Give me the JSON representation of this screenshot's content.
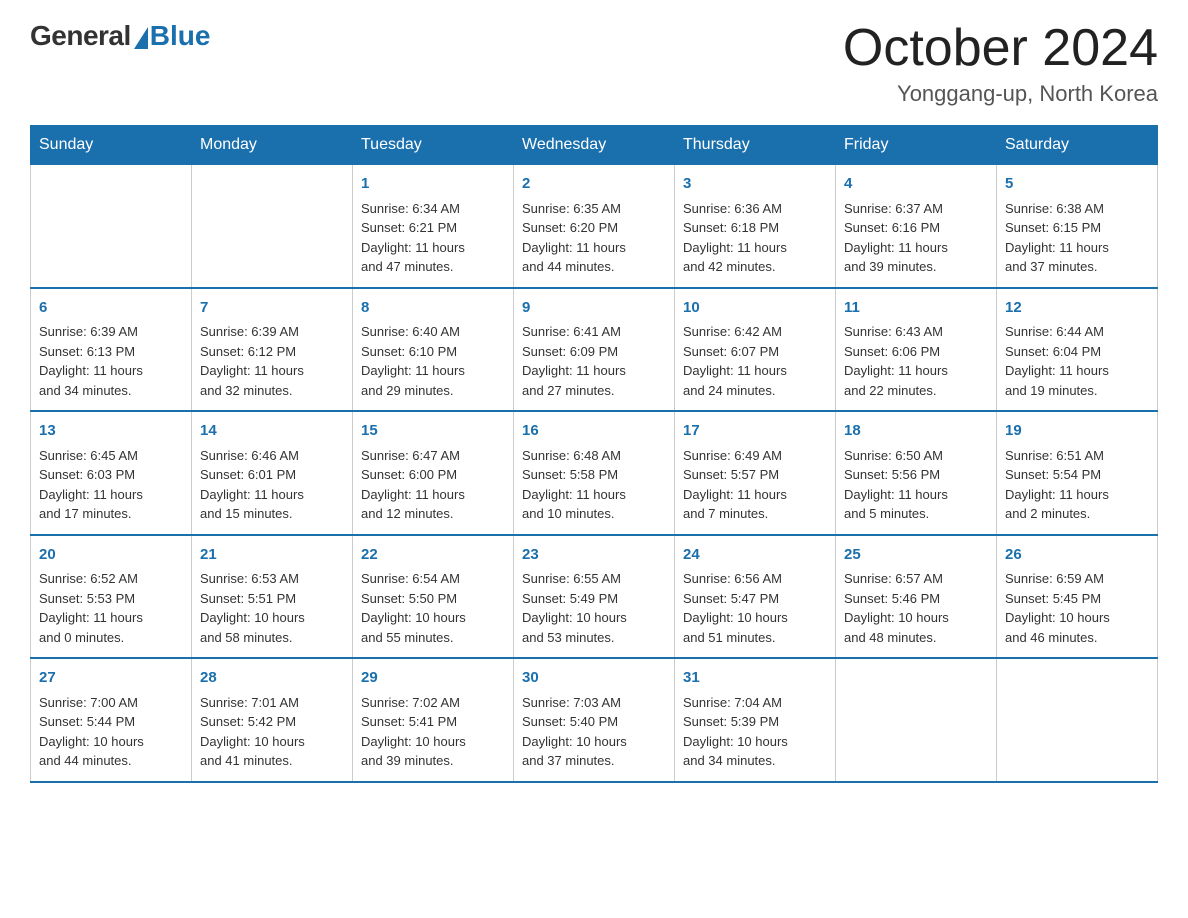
{
  "logo": {
    "general": "General",
    "blue": "Blue"
  },
  "title": "October 2024",
  "subtitle": "Yonggang-up, North Korea",
  "weekdays": [
    "Sunday",
    "Monday",
    "Tuesday",
    "Wednesday",
    "Thursday",
    "Friday",
    "Saturday"
  ],
  "weeks": [
    [
      {
        "day": "",
        "info": ""
      },
      {
        "day": "",
        "info": ""
      },
      {
        "day": "1",
        "info": "Sunrise: 6:34 AM\nSunset: 6:21 PM\nDaylight: 11 hours\nand 47 minutes."
      },
      {
        "day": "2",
        "info": "Sunrise: 6:35 AM\nSunset: 6:20 PM\nDaylight: 11 hours\nand 44 minutes."
      },
      {
        "day": "3",
        "info": "Sunrise: 6:36 AM\nSunset: 6:18 PM\nDaylight: 11 hours\nand 42 minutes."
      },
      {
        "day": "4",
        "info": "Sunrise: 6:37 AM\nSunset: 6:16 PM\nDaylight: 11 hours\nand 39 minutes."
      },
      {
        "day": "5",
        "info": "Sunrise: 6:38 AM\nSunset: 6:15 PM\nDaylight: 11 hours\nand 37 minutes."
      }
    ],
    [
      {
        "day": "6",
        "info": "Sunrise: 6:39 AM\nSunset: 6:13 PM\nDaylight: 11 hours\nand 34 minutes."
      },
      {
        "day": "7",
        "info": "Sunrise: 6:39 AM\nSunset: 6:12 PM\nDaylight: 11 hours\nand 32 minutes."
      },
      {
        "day": "8",
        "info": "Sunrise: 6:40 AM\nSunset: 6:10 PM\nDaylight: 11 hours\nand 29 minutes."
      },
      {
        "day": "9",
        "info": "Sunrise: 6:41 AM\nSunset: 6:09 PM\nDaylight: 11 hours\nand 27 minutes."
      },
      {
        "day": "10",
        "info": "Sunrise: 6:42 AM\nSunset: 6:07 PM\nDaylight: 11 hours\nand 24 minutes."
      },
      {
        "day": "11",
        "info": "Sunrise: 6:43 AM\nSunset: 6:06 PM\nDaylight: 11 hours\nand 22 minutes."
      },
      {
        "day": "12",
        "info": "Sunrise: 6:44 AM\nSunset: 6:04 PM\nDaylight: 11 hours\nand 19 minutes."
      }
    ],
    [
      {
        "day": "13",
        "info": "Sunrise: 6:45 AM\nSunset: 6:03 PM\nDaylight: 11 hours\nand 17 minutes."
      },
      {
        "day": "14",
        "info": "Sunrise: 6:46 AM\nSunset: 6:01 PM\nDaylight: 11 hours\nand 15 minutes."
      },
      {
        "day": "15",
        "info": "Sunrise: 6:47 AM\nSunset: 6:00 PM\nDaylight: 11 hours\nand 12 minutes."
      },
      {
        "day": "16",
        "info": "Sunrise: 6:48 AM\nSunset: 5:58 PM\nDaylight: 11 hours\nand 10 minutes."
      },
      {
        "day": "17",
        "info": "Sunrise: 6:49 AM\nSunset: 5:57 PM\nDaylight: 11 hours\nand 7 minutes."
      },
      {
        "day": "18",
        "info": "Sunrise: 6:50 AM\nSunset: 5:56 PM\nDaylight: 11 hours\nand 5 minutes."
      },
      {
        "day": "19",
        "info": "Sunrise: 6:51 AM\nSunset: 5:54 PM\nDaylight: 11 hours\nand 2 minutes."
      }
    ],
    [
      {
        "day": "20",
        "info": "Sunrise: 6:52 AM\nSunset: 5:53 PM\nDaylight: 11 hours\nand 0 minutes."
      },
      {
        "day": "21",
        "info": "Sunrise: 6:53 AM\nSunset: 5:51 PM\nDaylight: 10 hours\nand 58 minutes."
      },
      {
        "day": "22",
        "info": "Sunrise: 6:54 AM\nSunset: 5:50 PM\nDaylight: 10 hours\nand 55 minutes."
      },
      {
        "day": "23",
        "info": "Sunrise: 6:55 AM\nSunset: 5:49 PM\nDaylight: 10 hours\nand 53 minutes."
      },
      {
        "day": "24",
        "info": "Sunrise: 6:56 AM\nSunset: 5:47 PM\nDaylight: 10 hours\nand 51 minutes."
      },
      {
        "day": "25",
        "info": "Sunrise: 6:57 AM\nSunset: 5:46 PM\nDaylight: 10 hours\nand 48 minutes."
      },
      {
        "day": "26",
        "info": "Sunrise: 6:59 AM\nSunset: 5:45 PM\nDaylight: 10 hours\nand 46 minutes."
      }
    ],
    [
      {
        "day": "27",
        "info": "Sunrise: 7:00 AM\nSunset: 5:44 PM\nDaylight: 10 hours\nand 44 minutes."
      },
      {
        "day": "28",
        "info": "Sunrise: 7:01 AM\nSunset: 5:42 PM\nDaylight: 10 hours\nand 41 minutes."
      },
      {
        "day": "29",
        "info": "Sunrise: 7:02 AM\nSunset: 5:41 PM\nDaylight: 10 hours\nand 39 minutes."
      },
      {
        "day": "30",
        "info": "Sunrise: 7:03 AM\nSunset: 5:40 PM\nDaylight: 10 hours\nand 37 minutes."
      },
      {
        "day": "31",
        "info": "Sunrise: 7:04 AM\nSunset: 5:39 PM\nDaylight: 10 hours\nand 34 minutes."
      },
      {
        "day": "",
        "info": ""
      },
      {
        "day": "",
        "info": ""
      }
    ]
  ]
}
